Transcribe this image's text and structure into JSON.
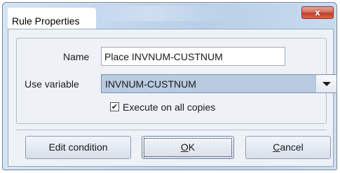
{
  "window": {
    "title": "Rule Properties",
    "close_glyph": "x"
  },
  "form": {
    "name_label": "Name",
    "name_value": "Place INVNUM-CUSTNUM",
    "variable_label": "Use variable",
    "variable_value": "INVNUM-CUSTNUM",
    "execute_label": "Execute on all copies",
    "execute_checked": true,
    "check_glyph": "✔"
  },
  "buttons": {
    "edit_condition": "Edit condition",
    "ok_mnemonic": "O",
    "ok_rest": "K",
    "cancel_mnemonic": "C",
    "cancel_rest": "ancel"
  }
}
